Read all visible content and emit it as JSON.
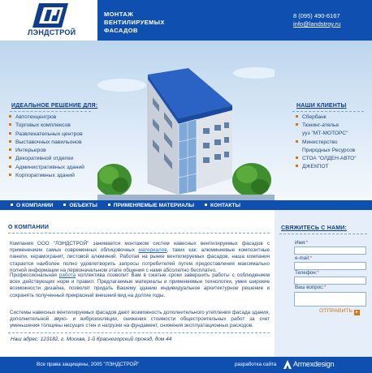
{
  "header": {
    "logo_text": "ЛЭНДСТРОЙ",
    "tagline_lines": [
      "МОНТАЖ",
      "ВЕНТИЛИРУЕМЫХ",
      "ФАСАДОВ"
    ],
    "phone": "8 (095) 490-6167",
    "email": "info@landstroy.ru"
  },
  "solutions": {
    "title": "ИДЕАЛЬНОЕ РЕШЕНИЕ ДЛЯ:",
    "items": [
      "Автотехцентров",
      "Торговых комплексов",
      "Развлекательных центров",
      "Выставочных павильонов",
      "Интерьеров",
      "Декоративной отделки",
      "Административных зданий",
      "Корпоративных зданий"
    ]
  },
  "clients": {
    "title": "НАШИ КЛИЕНТЫ",
    "items": [
      "Сбербанк",
      "Тюнинг-ателье",
      "ууз \"МТ-МОТОРС\"",
      "Министерство",
      "Природных Ресурсов",
      "СТОА \"ОЛДЕН-АВТО\"",
      "ДЖЕКПОТ"
    ]
  },
  "nav": {
    "items": [
      "О КОМПАНИИ",
      "ОБЪЕКТЫ",
      "ПРИМЕНЯЕМЫЕ МАТЕРИАЛЫ",
      "КОНТАКТЫ"
    ]
  },
  "about": {
    "title": "О КОМПАНИИ",
    "p1_a": "Компания ООО \"ЛЭНДСТРОЙ\" занимается монтажом систем навесных вентилируемых фасадов с применением самых современных облицовочных ",
    "p1_link": "материалов",
    "p1_b": ", таких как: алюминиевые композитные панели, керамогранит, листовой алюминий. Работая на рынке вентилируемых фасадов, наша компания старается наиболее полно удовлетворить запросы потребителей путем предоставления максимально полной информации на первоначальном этапе общения с нами абсолютно бесплатно.",
    "p2_a": "Профессиональная ",
    "p2_link": "работа",
    "p2_b": " коллектива позволит Вам в сжатые сроки завершить работы с соблюдением всех действующих норм и правил. Предлагаемые материалы и применяемые технологии, умея широкие возможности дизайна, позволят придать Вашему зданию индивидуальное архитектурное решение и сохранять полученный прекрасный внешний вид на долгие годы.",
    "p3": "Системы навесных вентилируемых фасадов дают возможность дополнительного утепления фасада здания, дополнительной звуко- и виброизоляции, снижения стоимости общестроительных работ за счет уменьшения толщины несущих стен и нагрузки на фундамент, снижения эксплуатационных расходов.",
    "address": "Наш адрес: 123182, г. Москва, 1-й Красногорский проезд, дом 44"
  },
  "form": {
    "title": "СВЯЖИТЕСЬ С НАМИ:",
    "name_label": "Имя:",
    "email_label": "e-mail:",
    "phone_label": "Телефон:",
    "question_label": "Ваш вопрос:",
    "required_mark": "*",
    "send_label": "ОТПРАВИТЬ",
    "send_arrow": "►"
  },
  "footer": {
    "copyright": "Все права защищены, 2005 \"ЛЭНДСТРОЙ\"",
    "developer_label": "разработка сайта",
    "developer_name": "Armexdesign"
  },
  "colors": {
    "brand_blue": "#0f4fb0",
    "accent_orange": "#d47512",
    "light_panel": "#e6eff9"
  }
}
